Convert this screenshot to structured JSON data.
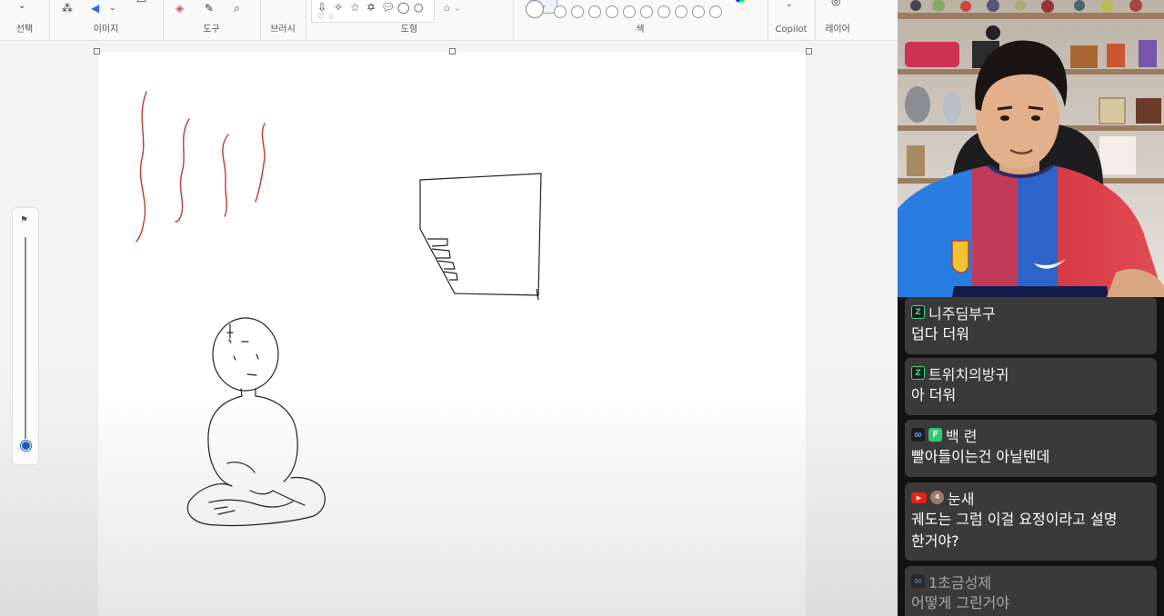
{
  "ribbon": {
    "groups": {
      "select": "선택",
      "image": "이미지",
      "tools": "도구",
      "brushes": "브러시",
      "shapes": "도형",
      "colors": "색",
      "copilot": "Copilot",
      "layers": "레이어"
    },
    "icons": [
      "select-icon",
      "crop-icon",
      "resize-icon",
      "eraser-icon",
      "color-picker-icon",
      "magnifier-icon",
      "brush-icon",
      "shape-arrow-down-icon",
      "shape-four-point-star-icon",
      "shape-five-point-star-icon",
      "shape-six-point-star-icon",
      "shape-callout-rect-icon",
      "shape-callout-oval-icon",
      "shape-callout-cloud-icon",
      "fill-icon",
      "copilot-icon",
      "layers-icon"
    ]
  },
  "chat": {
    "messages": [
      {
        "user": "니주딤부구",
        "text": "덥다 더워",
        "badges": [
          "z"
        ]
      },
      {
        "user": "트위치의방귀",
        "text": "아 더워",
        "badges": [
          "z"
        ]
      },
      {
        "user": "백 련",
        "text": "빨아들이는건 아닐텐데",
        "badges": [
          "infinity",
          "F"
        ]
      },
      {
        "user": "눈새",
        "text": "궤도는 그럼 이걸 요정이라고 설명\n한거야?",
        "badges": [
          "youtube",
          "circle"
        ]
      },
      {
        "user": "1초금성제",
        "text": "어떻게 그린거야",
        "badges": [
          "infinity"
        ]
      }
    ],
    "badge_glyphs": {
      "z": "Z",
      "infinity": "∞",
      "F": "F",
      "youtube": "▶",
      "circle": "4"
    }
  },
  "colors": {
    "red_stroke": "#c0392b",
    "ink": "#222222",
    "chat_bg": "#121212",
    "bubble_bg": "#3a3a3a",
    "zoom_thumb": "#1a5fb4"
  }
}
